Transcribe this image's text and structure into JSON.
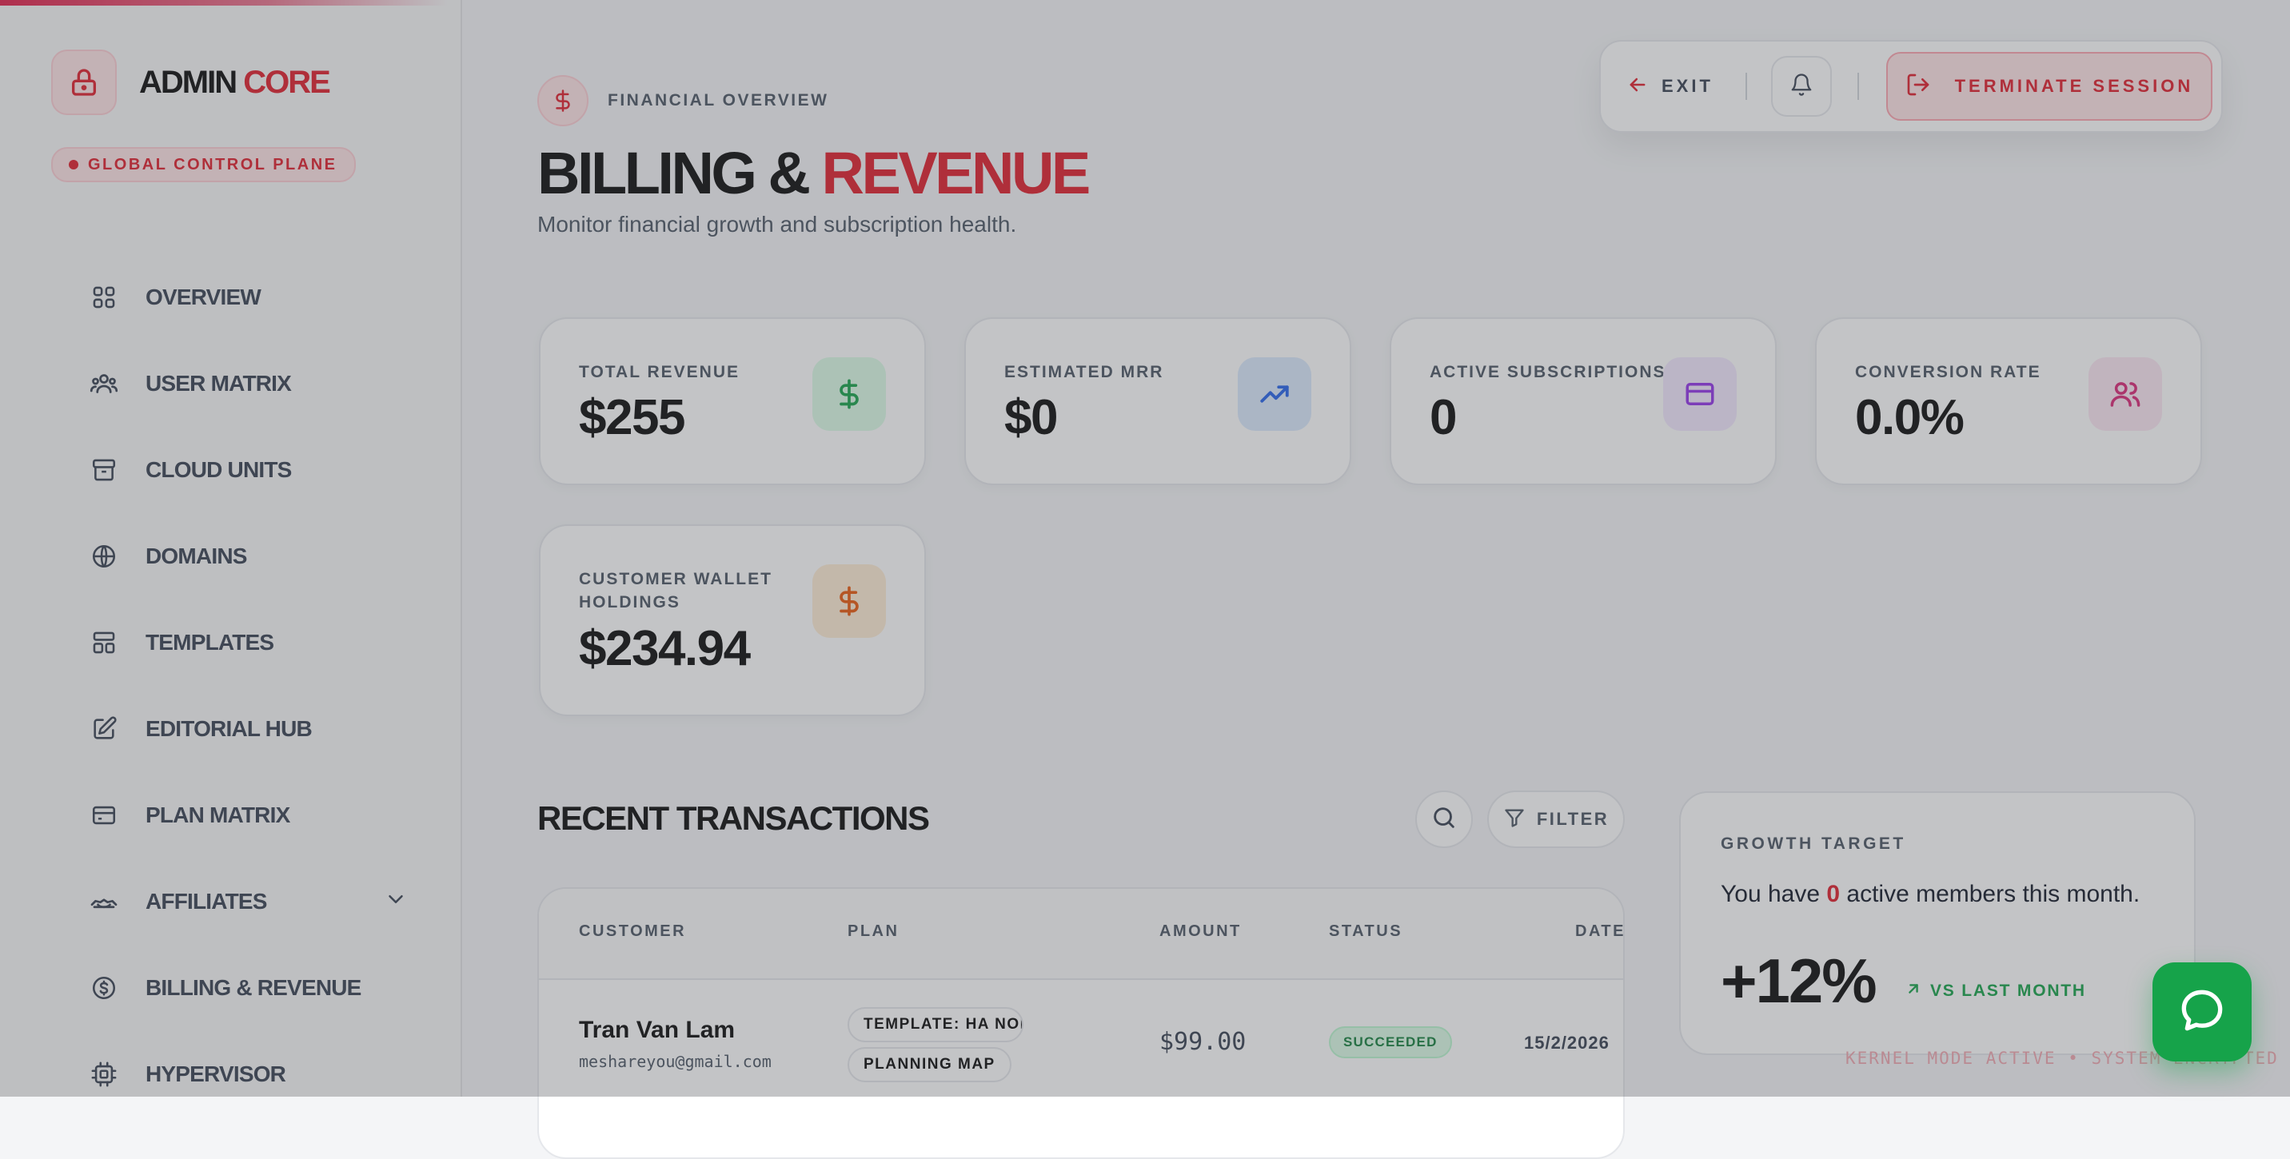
{
  "brand": {
    "name_primary": "ADMIN",
    "name_accent": "CORE"
  },
  "control_plane_badge": "GLOBAL CONTROL PLANE",
  "sidebar": {
    "items": [
      {
        "label": "OVERVIEW",
        "icon": "grid-icon"
      },
      {
        "label": "USER MATRIX",
        "icon": "users-icon"
      },
      {
        "label": "CLOUD UNITS",
        "icon": "archive-icon"
      },
      {
        "label": "DOMAINS",
        "icon": "globe-icon"
      },
      {
        "label": "TEMPLATES",
        "icon": "layout-icon"
      },
      {
        "label": "EDITORIAL HUB",
        "icon": "edit-icon"
      },
      {
        "label": "PLAN MATRIX",
        "icon": "card-icon"
      },
      {
        "label": "AFFILIATES",
        "icon": "handshake-icon",
        "has_submenu": true
      },
      {
        "label": "BILLING & REVENUE",
        "icon": "dollar-circle-icon"
      },
      {
        "label": "HYPERVISOR",
        "icon": "cpu-icon"
      }
    ]
  },
  "page": {
    "eyebrow": "FINANCIAL OVERVIEW",
    "title_primary": "BILLING &",
    "title_accent": "REVENUE",
    "subtitle": "Monitor financial growth and subscription health."
  },
  "header": {
    "exit_label": "EXIT",
    "terminate_label": "TERMINATE SESSION"
  },
  "stats": [
    {
      "label": "TOTAL REVENUE",
      "value": "$255",
      "icon": "dollar-icon",
      "icon_color": "#16a34a",
      "icon_bg": "#dcfce7"
    },
    {
      "label": "ESTIMATED MRR",
      "value": "$0",
      "icon": "trending-up-icon",
      "icon_color": "#2563eb",
      "icon_bg": "#dbeafe"
    },
    {
      "label": "ACTIVE SUBSCRIPTIONS",
      "value": "0",
      "icon": "credit-card-icon",
      "icon_color": "#9333ea",
      "icon_bg": "#f3e8ff"
    },
    {
      "label": "CONVERSION RATE",
      "value": "0.0%",
      "icon": "users-icon",
      "icon_color": "#db2777",
      "icon_bg": "#fce7f3"
    },
    {
      "label": "CUSTOMER WALLET HOLDINGS",
      "value": "$234.94",
      "icon": "dollar-icon",
      "icon_color": "#ea580c",
      "icon_bg": "#ffedd5"
    }
  ],
  "transactions": {
    "title": "RECENT TRANSACTIONS",
    "filter_label": "FILTER",
    "columns": [
      "CUSTOMER",
      "PLAN",
      "AMOUNT",
      "STATUS",
      "DATE"
    ],
    "rows": [
      {
        "customer": "Tran Van Lam",
        "email": "meshareyou@gmail.com",
        "plan_line1": "TEMPLATE: HA NOI",
        "plan_line2": "PLANNING MAP",
        "amount": "$99.00",
        "status": "SUCCEEDED",
        "date": "15/2/2026"
      }
    ]
  },
  "growth": {
    "label": "GROWTH TARGET",
    "text_before": "You have ",
    "count": "0",
    "text_after": " active members this month.",
    "value": "+12%",
    "compare": "VS LAST MONTH"
  },
  "footer": {
    "kernel_status": "KERNEL MODE ACTIVE • SYSTEM ENCRYPTED"
  },
  "colors": {
    "accent": "#e11d2b",
    "success": "#16a34a",
    "text": "#0a0a0a",
    "muted": "#4b5563"
  }
}
